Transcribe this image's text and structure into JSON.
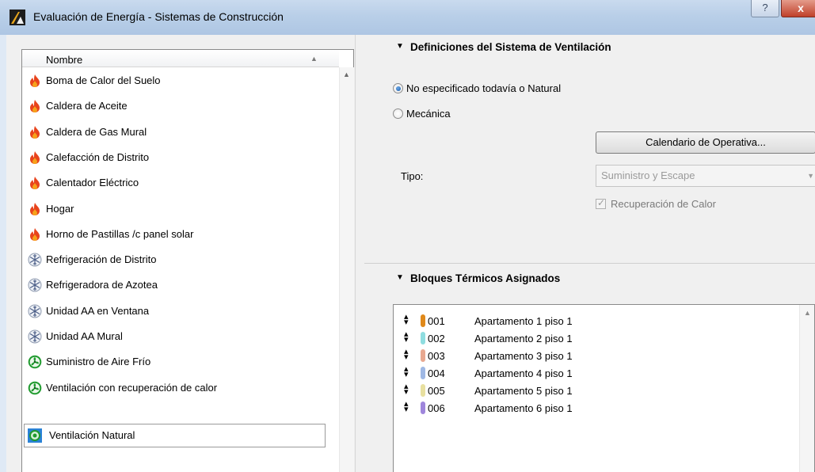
{
  "window": {
    "title": "Evaluación de Energía - Sistemas de Construcción",
    "help_label": "?",
    "close_label": "x"
  },
  "list": {
    "header": "Nombre",
    "items": [
      {
        "label": "Boma de Calor del Suelo",
        "icon": "flame-icon"
      },
      {
        "label": "Caldera de Aceite",
        "icon": "flame-icon"
      },
      {
        "label": "Caldera de Gas Mural",
        "icon": "flame-icon"
      },
      {
        "label": "Calefacción de Distrito",
        "icon": "flame-icon"
      },
      {
        "label": "Calentador Eléctrico",
        "icon": "flame-icon"
      },
      {
        "label": "Hogar",
        "icon": "flame-icon"
      },
      {
        "label": "Horno de Pastillas /c panel solar",
        "icon": "flame-icon"
      },
      {
        "label": "Refrigeración de Distrito",
        "icon": "snowflake-icon"
      },
      {
        "label": "Refrigeradora de Azotea",
        "icon": "snowflake-icon"
      },
      {
        "label": "Unidad AA en Ventana",
        "icon": "snowflake-icon"
      },
      {
        "label": "Unidad AA Mural",
        "icon": "snowflake-icon"
      },
      {
        "label": "Suministro de Aire Frío",
        "icon": "fan-icon"
      },
      {
        "label": "Ventilación con recuperación de calor",
        "icon": "fan-icon"
      },
      {
        "label": "Ventilación Natural",
        "icon": "natural-ventilation-icon",
        "selected": true
      }
    ]
  },
  "ventilation": {
    "section_title": "Definiciones del Sistema de Ventilación",
    "radio_natural": "No especificado todavía o Natural",
    "radio_mechanical": "Mecánica",
    "selected": "natural",
    "schedule_button": "Calendario de Operativa...",
    "type_label": "Tipo:",
    "type_value": "Suministro y Escape",
    "heat_recovery_label": "Recuperación de Calor",
    "heat_recovery_checked": true
  },
  "blocks": {
    "section_title": "Bloques Térmicos Asignados",
    "rows": [
      {
        "code": "001",
        "name": "Apartamento 1 piso 1",
        "color": "#e0891a"
      },
      {
        "code": "002",
        "name": "Apartamento 2 piso 1",
        "color": "#8fdde0"
      },
      {
        "code": "003",
        "name": "Apartamento 3 piso 1",
        "color": "#e8a890"
      },
      {
        "code": "004",
        "name": "Apartamento 4 piso 1",
        "color": "#9fb8e4"
      },
      {
        "code": "005",
        "name": "Apartamento 5 piso 1",
        "color": "#e8e0a0"
      },
      {
        "code": "006",
        "name": "Apartamento 6 piso 1",
        "color": "#9f86dc"
      }
    ]
  }
}
